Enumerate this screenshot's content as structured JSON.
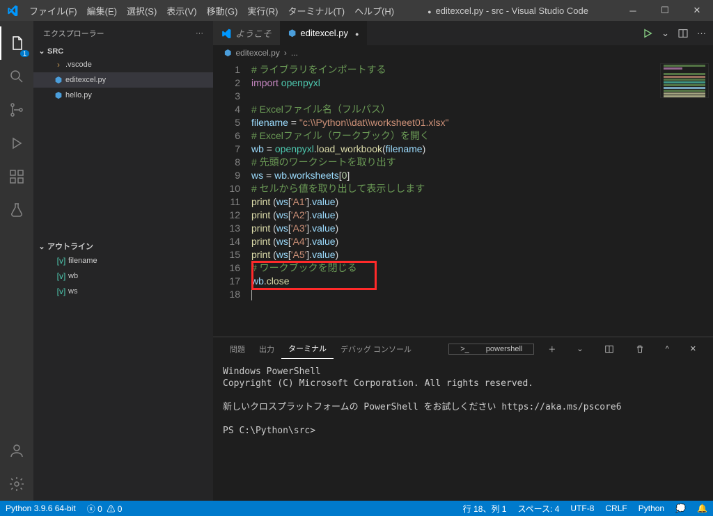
{
  "window": {
    "title": "editexcel.py - src - Visual Studio Code"
  },
  "menu": [
    "ファイル(F)",
    "編集(E)",
    "選択(S)",
    "表示(V)",
    "移動(G)",
    "実行(R)",
    "ターミナル(T)",
    "ヘルプ(H)"
  ],
  "explorer": {
    "title": "エクスプローラー",
    "root": "SRC",
    "items": [
      {
        "icon": "chev",
        "label": ".vscode",
        "depth": 1
      },
      {
        "icon": "py",
        "label": "editexcel.py",
        "depth": 1,
        "active": true
      },
      {
        "icon": "py",
        "label": "hello.py",
        "depth": 1
      }
    ],
    "outline_title": "アウトライン",
    "outline": [
      "filename",
      "wb",
      "ws"
    ]
  },
  "tabs": [
    {
      "icon": "vs",
      "label": "ようこそ",
      "active": false
    },
    {
      "icon": "py",
      "label": "editexcel.py",
      "active": true,
      "dirty": true
    }
  ],
  "breadcrumb": {
    "file": "editexcel.py",
    "rest": "..."
  },
  "code_lines": [
    [
      {
        "c": "tok-cm",
        "t": "# ライブラリをインポートする"
      }
    ],
    [
      {
        "c": "tok-kw",
        "t": "import"
      },
      {
        "c": "tok-op",
        "t": " "
      },
      {
        "c": "tok-mod",
        "t": "openpyxl"
      }
    ],
    [],
    [
      {
        "c": "tok-cm",
        "t": "# Excelファイル名（フルパス）"
      }
    ],
    [
      {
        "c": "tok-var",
        "t": "filename"
      },
      {
        "c": "tok-op",
        "t": " = "
      },
      {
        "c": "tok-str",
        "t": "\"c:\\\\Python\\\\dat\\\\worksheet01.xlsx\""
      }
    ],
    [
      {
        "c": "tok-cm",
        "t": "# Excelファイル（ワークブック）を開く"
      }
    ],
    [
      {
        "c": "tok-var",
        "t": "wb"
      },
      {
        "c": "tok-op",
        "t": " = "
      },
      {
        "c": "tok-mod",
        "t": "openpyxl"
      },
      {
        "c": "tok-op",
        "t": "."
      },
      {
        "c": "tok-fn",
        "t": "load_workbook"
      },
      {
        "c": "tok-op",
        "t": "("
      },
      {
        "c": "tok-var",
        "t": "filename"
      },
      {
        "c": "tok-op",
        "t": ")"
      }
    ],
    [
      {
        "c": "tok-cm",
        "t": "# 先頭のワークシートを取り出す"
      }
    ],
    [
      {
        "c": "tok-var",
        "t": "ws"
      },
      {
        "c": "tok-op",
        "t": " = "
      },
      {
        "c": "tok-var",
        "t": "wb"
      },
      {
        "c": "tok-op",
        "t": "."
      },
      {
        "c": "tok-var",
        "t": "worksheets"
      },
      {
        "c": "tok-op",
        "t": "["
      },
      {
        "c": "tok-num",
        "t": "0"
      },
      {
        "c": "tok-op",
        "t": "]"
      }
    ],
    [
      {
        "c": "tok-cm",
        "t": "# セルから値を取り出して表示しします"
      }
    ],
    [
      {
        "c": "tok-fn",
        "t": "print"
      },
      {
        "c": "tok-op",
        "t": " ("
      },
      {
        "c": "tok-var",
        "t": "ws"
      },
      {
        "c": "tok-op",
        "t": "["
      },
      {
        "c": "tok-str",
        "t": "'A1'"
      },
      {
        "c": "tok-op",
        "t": "]."
      },
      {
        "c": "tok-var",
        "t": "value"
      },
      {
        "c": "tok-op",
        "t": ")"
      }
    ],
    [
      {
        "c": "tok-fn",
        "t": "print"
      },
      {
        "c": "tok-op",
        "t": " ("
      },
      {
        "c": "tok-var",
        "t": "ws"
      },
      {
        "c": "tok-op",
        "t": "["
      },
      {
        "c": "tok-str",
        "t": "'A2'"
      },
      {
        "c": "tok-op",
        "t": "]."
      },
      {
        "c": "tok-var",
        "t": "value"
      },
      {
        "c": "tok-op",
        "t": ")"
      }
    ],
    [
      {
        "c": "tok-fn",
        "t": "print"
      },
      {
        "c": "tok-op",
        "t": " ("
      },
      {
        "c": "tok-var",
        "t": "ws"
      },
      {
        "c": "tok-op",
        "t": "["
      },
      {
        "c": "tok-str",
        "t": "'A3'"
      },
      {
        "c": "tok-op",
        "t": "]."
      },
      {
        "c": "tok-var",
        "t": "value"
      },
      {
        "c": "tok-op",
        "t": ")"
      }
    ],
    [
      {
        "c": "tok-fn",
        "t": "print"
      },
      {
        "c": "tok-op",
        "t": " ("
      },
      {
        "c": "tok-var",
        "t": "ws"
      },
      {
        "c": "tok-op",
        "t": "["
      },
      {
        "c": "tok-str",
        "t": "'A4'"
      },
      {
        "c": "tok-op",
        "t": "]."
      },
      {
        "c": "tok-var",
        "t": "value"
      },
      {
        "c": "tok-op",
        "t": ")"
      }
    ],
    [
      {
        "c": "tok-fn",
        "t": "print"
      },
      {
        "c": "tok-op",
        "t": " ("
      },
      {
        "c": "tok-var",
        "t": "ws"
      },
      {
        "c": "tok-op",
        "t": "["
      },
      {
        "c": "tok-str",
        "t": "'A5'"
      },
      {
        "c": "tok-op",
        "t": "]."
      },
      {
        "c": "tok-var",
        "t": "value"
      },
      {
        "c": "tok-op",
        "t": ")"
      }
    ],
    [
      {
        "c": "tok-cm",
        "t": "# ワークブックを閉じる"
      }
    ],
    [
      {
        "c": "tok-var",
        "t": "wb"
      },
      {
        "c": "tok-op",
        "t": "."
      },
      {
        "c": "tok-fn",
        "t": "close"
      }
    ],
    []
  ],
  "panel": {
    "tabs": [
      "問題",
      "出力",
      "ターミナル",
      "デバッグ コンソール"
    ],
    "active": 2,
    "shell_label": "powershell",
    "text": "Windows PowerShell\nCopyright (C) Microsoft Corporation. All rights reserved.\n\n新しいクロスプラットフォームの PowerShell をお試しください https://aka.ms/pscore6\n\nPS C:\\Python\\src>"
  },
  "status": {
    "python": "Python 3.9.6 64-bit",
    "errors": "0",
    "warnings": "0",
    "line_col": "行 18、列 1",
    "spaces": "スペース: 4",
    "encoding": "UTF-8",
    "eol": "CRLF",
    "lang": "Python"
  }
}
